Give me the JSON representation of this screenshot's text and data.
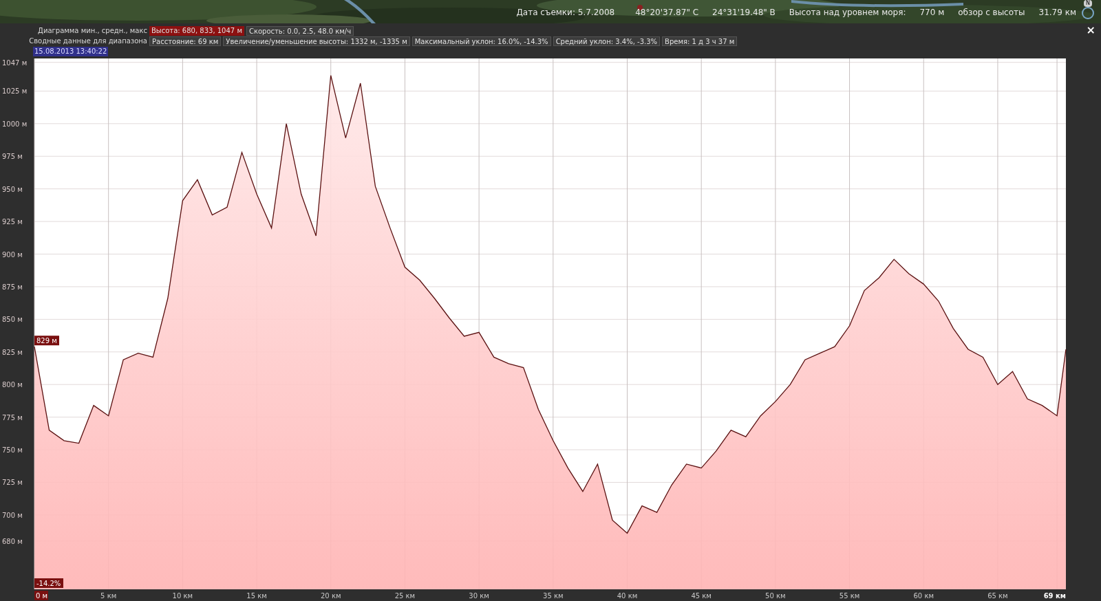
{
  "map_status": {
    "items": [
      "Дата съемки: 5.7.2008",
      "48°20'37.87\" С",
      "24°31'19.48\" В",
      "Высота над уровнем моря:",
      "770 м",
      "обзор с высоты",
      "31.79 км"
    ],
    "compass_letter": "N"
  },
  "profile_panel": {
    "close": "×",
    "rows": [
      {
        "label": "Диаграмма мин., средн., макс",
        "items": [
          {
            "text": "Высота: 680, 833, 1047 м",
            "selected": true
          },
          {
            "text": "Скорость: 0.0, 2.5, 48.0 км/ч",
            "selected": false
          }
        ]
      },
      {
        "label": "Сводные данные для диапазона",
        "items": [
          {
            "text": "Расстояние: 69 км",
            "selected": false
          },
          {
            "text": "Увеличение/уменьшение высоты: 1332 м, -1335 м",
            "selected": false
          },
          {
            "text": "Максимальный уклон: 16.0%, -14.3%",
            "selected": false
          },
          {
            "text": "Средний уклон: 3.4%, -3.3%",
            "selected": false
          },
          {
            "text": "Время: 1 д 3 ч 37 м",
            "selected": false
          }
        ]
      }
    ],
    "timestamp": "15.08.2013 13:40:22",
    "chart_data": {
      "type": "area",
      "xlim": [
        0,
        69.6
      ],
      "ylim": [
        643,
        1050
      ],
      "x": [
        0,
        1,
        2,
        3,
        4,
        5,
        6,
        7,
        8,
        9,
        10,
        11,
        12,
        13,
        14,
        15,
        16,
        17,
        18,
        19,
        20,
        21,
        22,
        23,
        24,
        25,
        26,
        27,
        28,
        29,
        30,
        31,
        32,
        33,
        34,
        35,
        36,
        37,
        38,
        39,
        40,
        41,
        42,
        43,
        44,
        45,
        46,
        47,
        48,
        49,
        50,
        51,
        52,
        53,
        54,
        55,
        56,
        57,
        58,
        59,
        60,
        61,
        62,
        63,
        64,
        65,
        66,
        67,
        68,
        69,
        69.6
      ],
      "grid": true,
      "series": [
        {
          "color": "#5a1010",
          "values": [
            829,
            765,
            757,
            755,
            784,
            776,
            819,
            824,
            821,
            866,
            941,
            957,
            930,
            936,
            978,
            946,
            920,
            1000,
            946,
            914,
            1037,
            989,
            1031,
            952,
            920,
            890,
            880,
            866,
            851,
            837,
            840,
            821,
            816,
            813,
            781,
            757,
            736,
            718,
            739,
            696,
            686,
            707,
            702,
            723,
            739,
            736,
            749,
            765,
            760,
            776,
            787,
            800,
            819,
            824,
            829,
            845,
            872,
            882,
            896,
            885,
            877,
            864,
            843,
            827,
            821,
            800,
            810,
            789,
            784,
            776,
            827
          ]
        }
      ],
      "yticks": [
        {
          "value": 680,
          "label": "680 м"
        },
        {
          "value": 700,
          "label": "700 м"
        },
        {
          "value": 725,
          "label": "725 м"
        },
        {
          "value": 750,
          "label": "750 м"
        },
        {
          "value": 775,
          "label": "775 м"
        },
        {
          "value": 800,
          "label": "800 м"
        },
        {
          "value": 825,
          "label": "825 м"
        },
        {
          "value": 850,
          "label": "850 м"
        },
        {
          "value": 875,
          "label": "875 м"
        },
        {
          "value": 900,
          "label": "900 м"
        },
        {
          "value": 925,
          "label": "925 м"
        },
        {
          "value": 950,
          "label": "950 м"
        },
        {
          "value": 975,
          "label": "975 м"
        },
        {
          "value": 1000,
          "label": "1000 м"
        },
        {
          "value": 1025,
          "label": "1025 м"
        },
        {
          "value": 1047,
          "label": "1047 м"
        }
      ],
      "xticks": [
        {
          "value": 0,
          "label": "0 м"
        },
        {
          "value": 5,
          "label": "5 км"
        },
        {
          "value": 10,
          "label": "10 км"
        },
        {
          "value": 15,
          "label": "15 км"
        },
        {
          "value": 20,
          "label": "20 км"
        },
        {
          "value": 25,
          "label": "25 км"
        },
        {
          "value": 30,
          "label": "30 км"
        },
        {
          "value": 35,
          "label": "35 км"
        },
        {
          "value": 40,
          "label": "40 км"
        },
        {
          "value": 45,
          "label": "45 км"
        },
        {
          "value": 50,
          "label": "50 км"
        },
        {
          "value": 55,
          "label": "55 км"
        },
        {
          "value": 60,
          "label": "60 км"
        },
        {
          "value": 65,
          "label": "65 км"
        },
        {
          "value": 69,
          "label": "69 км"
        }
      ],
      "annotations": [
        {
          "text": "829 м",
          "x": 0,
          "y": 829
        },
        {
          "text": "-14.2%",
          "x": 0,
          "y": 650
        }
      ]
    }
  }
}
